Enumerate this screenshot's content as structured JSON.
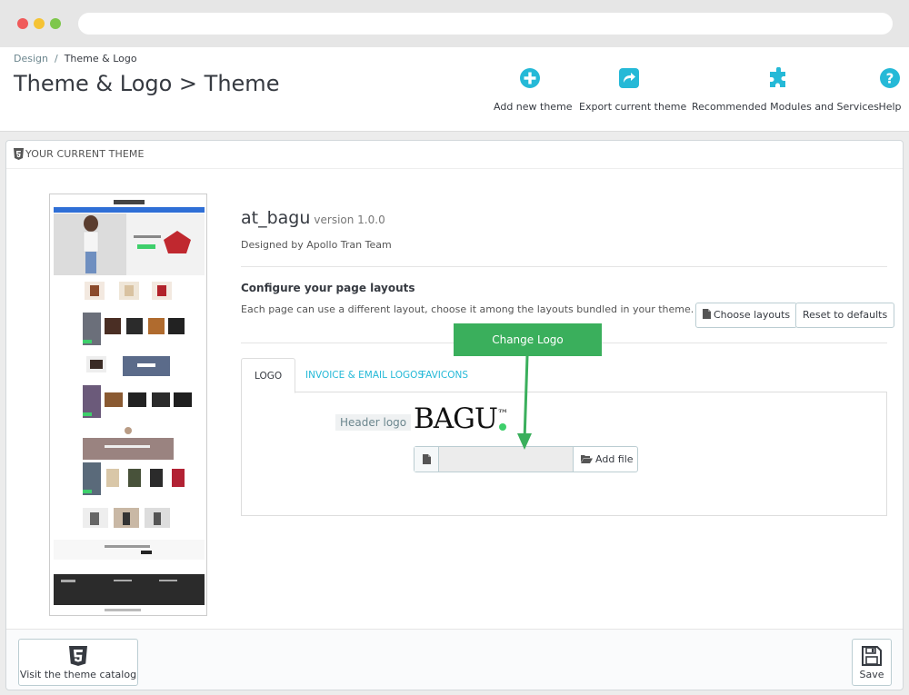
{
  "breadcrumb": {
    "parent": "Design",
    "current": "Theme & Logo"
  },
  "page_title": "Theme & Logo > Theme",
  "toolbar": {
    "add_new_theme": "Add new theme",
    "export_current_theme": "Export current theme",
    "recommended_modules": "Recommended Modules and Services",
    "help": "Help"
  },
  "panel": {
    "heading": "YOUR CURRENT THEME"
  },
  "theme": {
    "name": "at_bagu",
    "version": "version 1.0.0",
    "author": "Designed by Apollo Tran Team"
  },
  "layouts": {
    "title": "Configure your page layouts",
    "description": "Each page can use a different layout, choose it among the layouts bundled in your theme.",
    "choose_button": "Choose layouts",
    "reset_button": "Reset to defaults"
  },
  "callout": {
    "text": "Change Logo"
  },
  "tabs": [
    {
      "label": "LOGO",
      "active": true
    },
    {
      "label": "INVOICE & EMAIL LOGOS",
      "active": false
    },
    {
      "label": "FAVICONS",
      "active": false
    }
  ],
  "logo_tab": {
    "header_logo_label": "Header logo",
    "logo_text": "BAGU",
    "logo_tm": "™",
    "add_file_button": "Add file"
  },
  "footer": {
    "catalog_button": "Visit the theme catalog",
    "save_button": "Save"
  },
  "colors": {
    "accent": "#25b9d7",
    "callout": "#3aaf5c",
    "logo_dot": "#3ecf6b"
  }
}
